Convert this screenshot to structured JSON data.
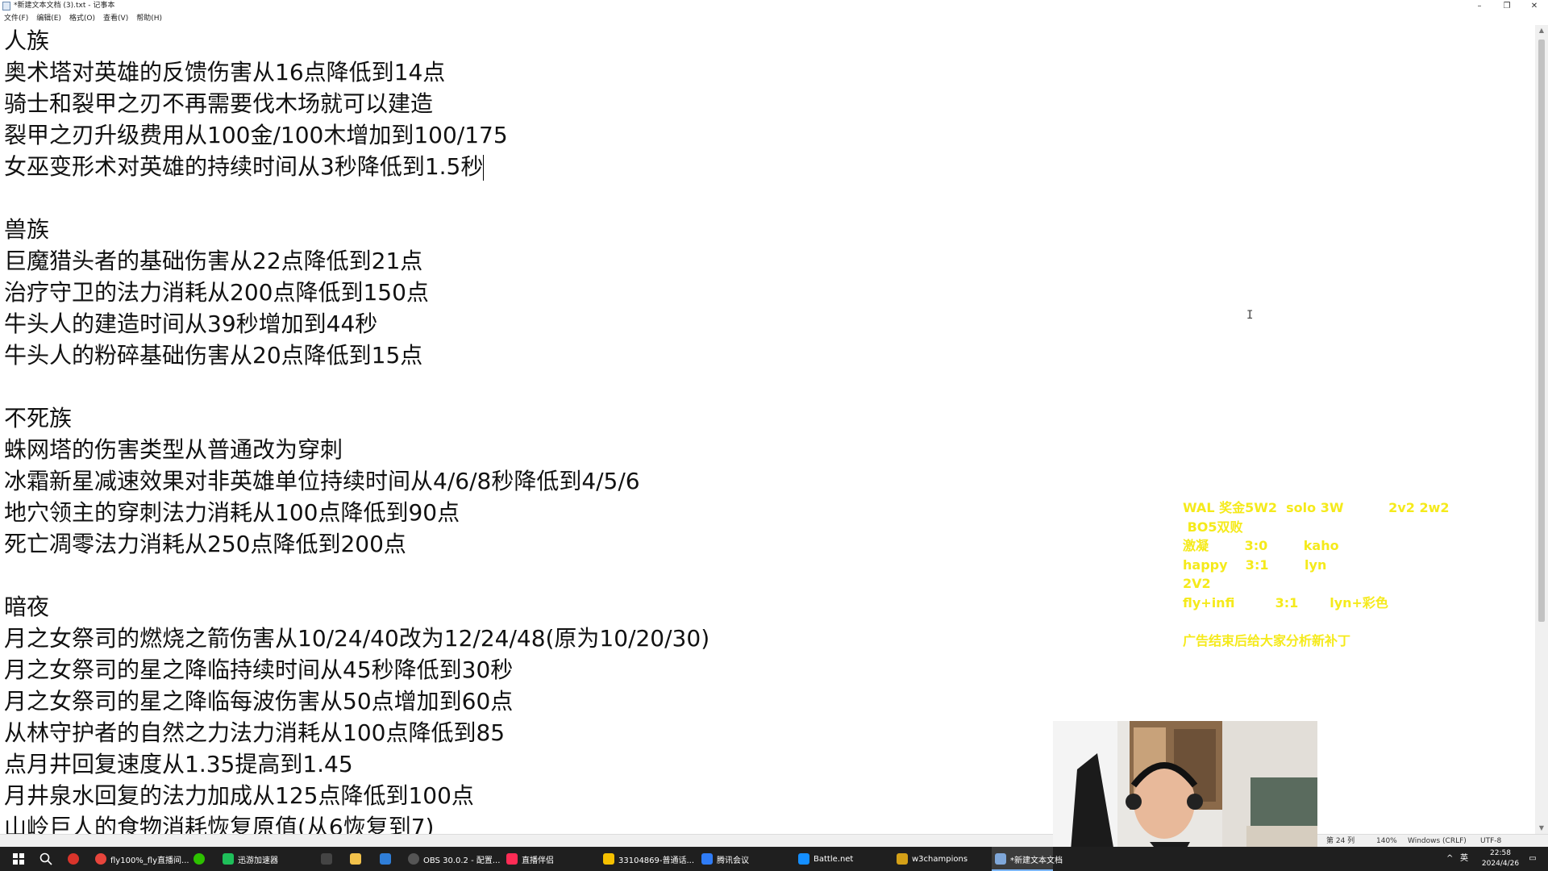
{
  "window": {
    "title": "*新建文本文档 (3).txt - 记事本",
    "controls": {
      "minimize": "–",
      "maximize": "❐",
      "close": "✕"
    }
  },
  "menu": [
    "文件(F)",
    "编辑(E)",
    "格式(O)",
    "查看(V)",
    "帮助(H)"
  ],
  "editor": {
    "lines": [
      "人族",
      "奥术塔对英雄的反馈伤害从16点降低到14点",
      "骑士和裂甲之刃不再需要伐木场就可以建造",
      "裂甲之刃升级费用从100金/100木增加到100/175",
      "女巫变形术对英雄的持续时间从3秒降低到1.5秒",
      "",
      "兽族",
      "巨魔猎头者的基础伤害从22点降低到21点",
      "治疗守卫的法力消耗从200点降低到150点",
      "牛头人的建造时间从39秒增加到44秒",
      "牛头人的粉碎基础伤害从20点降低到15点",
      "",
      "不死族",
      "蛛网塔的伤害类型从普通改为穿刺",
      "冰霜新星减速效果对非英雄单位持续时间从4/6/8秒降低到4/5/6",
      "地穴领主的穿刺法力消耗从100点降低到90点",
      "死亡凋零法力消耗从250点降低到200点",
      "",
      "暗夜",
      "月之女祭司的燃烧之箭伤害从10/24/40改为12/24/48(原为10/20/30)",
      "月之女祭司的星之降临持续时间从45秒降低到30秒",
      "月之女祭司的星之降临每波伤害从50点增加到60点",
      "从林守护者的自然之力法力消耗从100点降低到85",
      "点月井回复速度从1.35提高到1.45",
      "月井泉水回复的法力加成从125点降低到100点",
      "山岭巨人的食物消耗恢复原值(从6恢复到7)"
    ]
  },
  "status": {
    "position": "第 24 列",
    "zoom": "140%",
    "line_ending": "Windows (CRLF)",
    "encoding": "UTF-8"
  },
  "overlay": {
    "color": "#f5ea1b",
    "lines": [
      "WAL 奖金5W2  solo 3W          2v2 2w2",
      " BO5双败",
      "激凝        3:0        kaho",
      "happy    3:1        lyn",
      "2V2",
      "fly+infi         3:1       lyn+彩色",
      "",
      "广告结束后给大家分析新补丁"
    ]
  },
  "taskbar": {
    "items": [
      {
        "label": "fly100%_fly直播间...",
        "icon": "chrome-icon",
        "color": "#e8453c"
      },
      {
        "label": "",
        "icon": "wechat-icon",
        "color": "#2dc100"
      },
      {
        "label": "迅游加速器",
        "icon": "xunyou-icon",
        "color": "#1fbf5a"
      },
      {
        "label": "",
        "icon": "kk-icon",
        "color": "#444444"
      },
      {
        "label": "",
        "icon": "file-explorer-icon",
        "color": "#f2c24b"
      },
      {
        "label": "",
        "icon": "vscode-icon",
        "color": "#2f7ed8"
      },
      {
        "label": "OBS 30.0.2 - 配置...",
        "icon": "obs-icon",
        "color": "#555555"
      },
      {
        "label": "直播伴侣",
        "icon": "live-companion-icon",
        "color": "#fe2c55"
      },
      {
        "label": "33104869-普通话...",
        "icon": "yy-icon",
        "color": "#f5c000"
      },
      {
        "label": "腾讯会议",
        "icon": "tencent-meeting-icon",
        "color": "#2f7cf6"
      },
      {
        "label": "Battle.net",
        "icon": "battlenet-icon",
        "color": "#148eff"
      },
      {
        "label": "w3champions",
        "icon": "w3champions-icon",
        "color": "#d4a017"
      },
      {
        "label": "*新建文本文档",
        "icon": "notepad-icon",
        "color": "#7fa7d9"
      }
    ],
    "tray": {
      "ime": "英",
      "time": "22:58",
      "date": "2024/4/26"
    }
  }
}
